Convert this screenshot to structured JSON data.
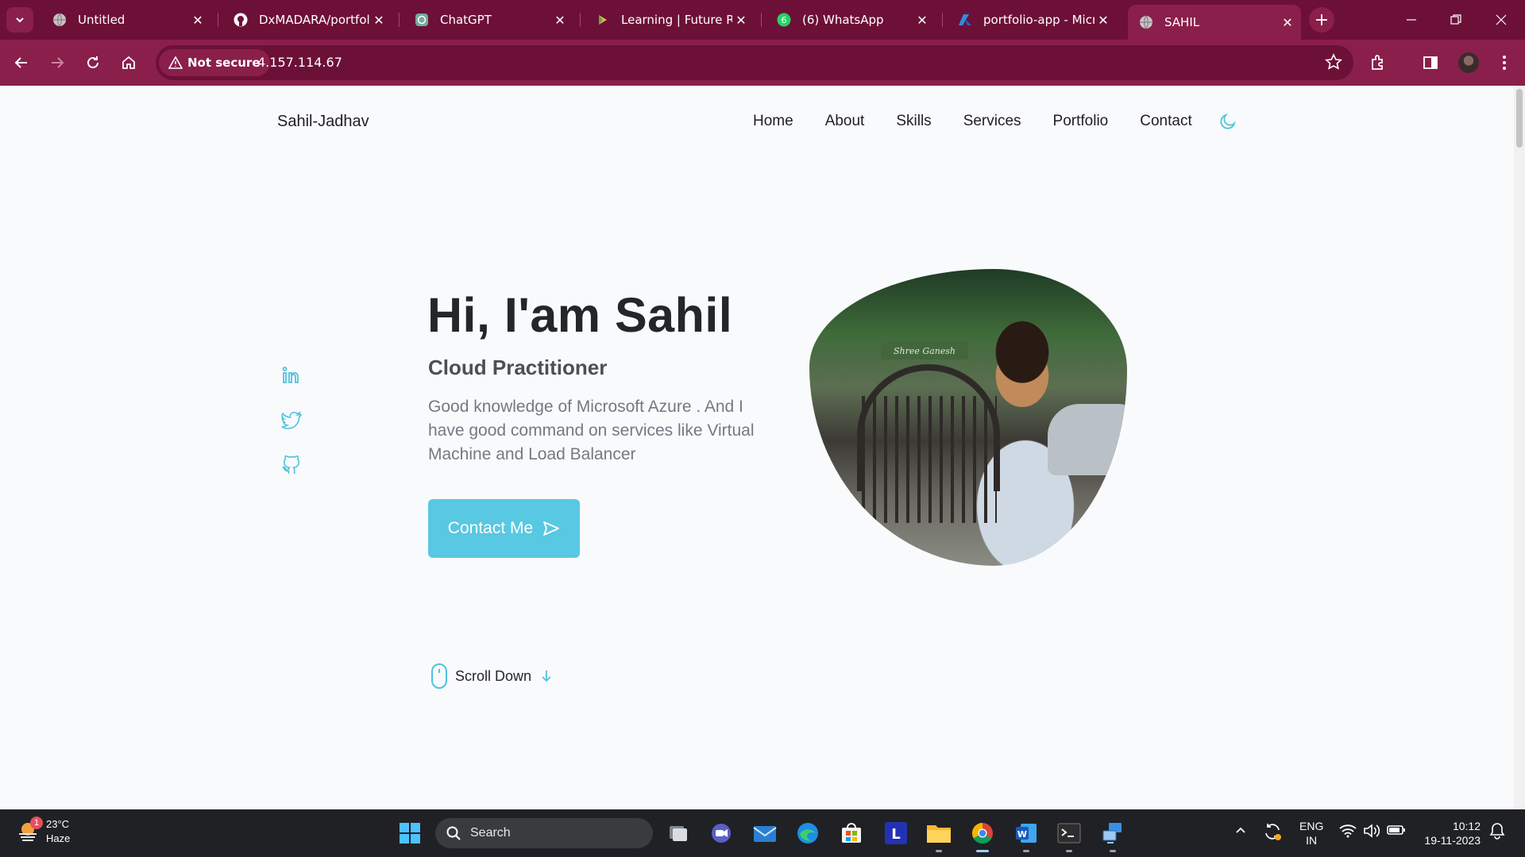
{
  "browser": {
    "tabs": [
      {
        "title": "Untitled",
        "icon": "globe-icon"
      },
      {
        "title": "DxMADARA/portfolio",
        "icon": "github-icon"
      },
      {
        "title": "ChatGPT",
        "icon": "chatgpt-icon"
      },
      {
        "title": "Learning | Future Rea",
        "icon": "play-icon"
      },
      {
        "title": "(6) WhatsApp",
        "icon": "whatsapp-icon"
      },
      {
        "title": "portfolio-app - Micro",
        "icon": "azure-icon"
      },
      {
        "title": "SAHIL",
        "icon": "globe-icon"
      }
    ],
    "active_tab": 6,
    "security_label": "Not secure",
    "url": "4.157.114.67",
    "colors": {
      "tabbar": "#6d1038",
      "toolbar": "#8a1f4b"
    }
  },
  "site": {
    "logo": "Sahil-Jadhav",
    "nav": [
      "Home",
      "About",
      "Skills",
      "Services",
      "Portfolio",
      "Contact"
    ],
    "theme_icon": "moon-icon",
    "socials": [
      "linkedin-icon",
      "twitter-icon",
      "github-icon"
    ],
    "hero": {
      "title": "Hi, I'am Sahil",
      "subtitle": "Cloud Practitioner",
      "description": "Good knowledge of Microsoft Azure . And I have good command on services like Virtual Machine and Load Balancer",
      "cta": "Contact Me",
      "photo_sign_text": "Shree Ganesh"
    },
    "scroll_down": "Scroll Down",
    "accent": "#59c8e2"
  },
  "taskbar": {
    "weather": {
      "temp": "23°C",
      "condition": "Haze",
      "badge": "1"
    },
    "search_placeholder": "Search",
    "lang": {
      "line1": "ENG",
      "line2": "IN"
    },
    "clock": {
      "time": "10:12",
      "date": "19-11-2023"
    }
  }
}
